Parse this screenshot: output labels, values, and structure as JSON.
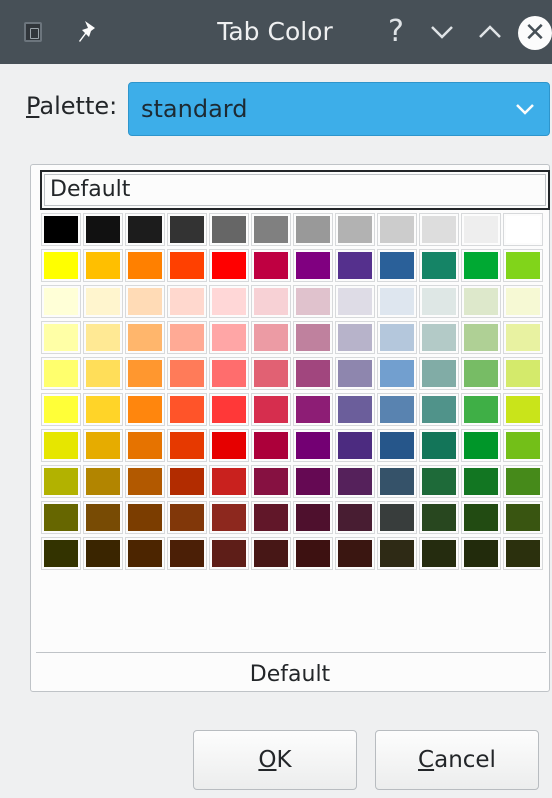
{
  "titlebar": {
    "title": "Tab Color",
    "help_label": "?",
    "app_icon": "document-icon",
    "pin_icon": "pin-icon",
    "close_icon": "close-icon"
  },
  "palette": {
    "label_accel": "P",
    "label_rest": "alette:",
    "selected": "standard"
  },
  "default_field": "Default",
  "colors": [
    [
      "#000000",
      "#111111",
      "#1c1c1c",
      "#333333",
      "#666666",
      "#808080",
      "#999999",
      "#b2b2b2",
      "#cccccc",
      "#dddddd",
      "#eeeeee",
      "#ffffff"
    ],
    [
      "#ffff00",
      "#ffbf00",
      "#ff8000",
      "#ff4000",
      "#ff0000",
      "#bf0041",
      "#800080",
      "#55308d",
      "#2a6099",
      "#158466",
      "#00a933",
      "#81d41a"
    ],
    [
      "#ffffd7",
      "#fff5ce",
      "#ffdbb6",
      "#ffd8ce",
      "#ffd7d7",
      "#f7d1d5",
      "#e0c2cd",
      "#dedce6",
      "#dee6ef",
      "#dee7e5",
      "#dde8cb",
      "#f6f9d4"
    ],
    [
      "#ffffa6",
      "#ffe994",
      "#ffb66c",
      "#ffaa95",
      "#ffa6a6",
      "#ec9ba4",
      "#bf819e",
      "#b7b3ca",
      "#b4c7dc",
      "#b3cac7",
      "#afd095",
      "#e8f2a1"
    ],
    [
      "#ffff6d",
      "#ffde59",
      "#ff972f",
      "#ff7b59",
      "#ff6d6d",
      "#e16173",
      "#a1467e",
      "#8e86ae",
      "#729fcf",
      "#81aca6",
      "#77bc65",
      "#d4ea6b"
    ],
    [
      "#ffff38",
      "#ffd428",
      "#ff860d",
      "#ff5429",
      "#ff3838",
      "#d62e4e",
      "#8d1d75",
      "#6b5e9b",
      "#5983b0",
      "#50938a",
      "#3faf46",
      "#c9e41a"
    ],
    [
      "#e6e600",
      "#e6ac00",
      "#e67300",
      "#e63900",
      "#e60000",
      "#ac003a",
      "#730073",
      "#4c2b80",
      "#26568a",
      "#137559",
      "#009629",
      "#73bf18"
    ],
    [
      "#b2b200",
      "#b28500",
      "#b25900",
      "#b22c00",
      "#c9211e",
      "#861141",
      "#650953",
      "#55215b",
      "#355269",
      "#1e6a39",
      "#127622",
      "#468a1a"
    ],
    [
      "#666600",
      "#784b04",
      "#7b3d00",
      "#813709",
      "#8d281e",
      "#611729",
      "#4e102d",
      "#481d32",
      "#383d3c",
      "#28471f",
      "#224b12",
      "#395511"
    ],
    [
      "#333300",
      "#3a2500",
      "#4c2500",
      "#4b1f06",
      "#5e1e18",
      "#471716",
      "#3d1111",
      "#3a1611",
      "#2e2a15",
      "#252c0f",
      "#222b0c",
      "#2b300d"
    ]
  ],
  "footer_label": "Default",
  "buttons": {
    "ok_accel": "O",
    "ok_rest": "K",
    "cancel_accel": "C",
    "cancel_rest": "ancel"
  }
}
